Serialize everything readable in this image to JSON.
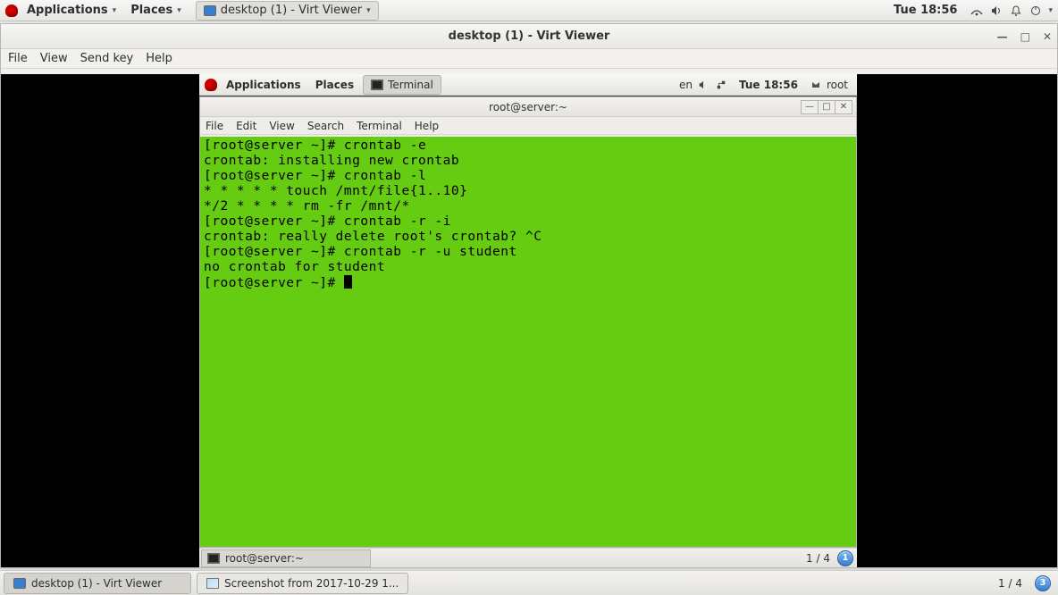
{
  "outer_panel": {
    "apps_label": "Applications",
    "places_label": "Places",
    "active_window_label": "desktop (1) - Virt Viewer",
    "clock": "Tue 18:56"
  },
  "viewer": {
    "title": "desktop (1) - Virt Viewer",
    "menus": {
      "file": "File",
      "view": "View",
      "sendkey": "Send key",
      "help": "Help"
    }
  },
  "guest_panel": {
    "apps_label": "Applications",
    "places_label": "Places",
    "terminal_task": "Terminal",
    "lang": "en",
    "clock": "Tue 18:56",
    "user": "root"
  },
  "terminal": {
    "title": "root@server:~",
    "menus": {
      "file": "File",
      "edit": "Edit",
      "view": "View",
      "search": "Search",
      "terminal": "Terminal",
      "help": "Help"
    },
    "lines": [
      "[root@server ~]# crontab -e",
      "crontab: installing new crontab",
      "[root@server ~]# crontab -l",
      "* * * * * touch /mnt/file{1..10}",
      "*/2 * * * * rm -fr /mnt/*",
      "[root@server ~]# crontab -r -i",
      "crontab: really delete root's crontab? ^C",
      "[root@server ~]# crontab -r -u student",
      "no crontab for student",
      "[root@server ~]# "
    ]
  },
  "guest_bottom": {
    "task_label": "root@server:~",
    "workspace_label": "1 / 4",
    "badge": "1"
  },
  "host_bottom": {
    "task1": "desktop (1) - Virt Viewer",
    "task2": "Screenshot from 2017-10-29 1...",
    "workspace_label": "1 / 4",
    "badge": "3"
  }
}
